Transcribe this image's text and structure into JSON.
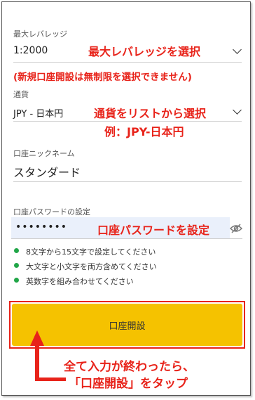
{
  "leverage": {
    "label": "最大レバレッジ",
    "value": "1:2000",
    "annotation": "最大レバレッジを選択",
    "note": "(新規口座開設は無制限を選択できません)"
  },
  "currency": {
    "label": "通貨",
    "value": "JPY - 日本円",
    "annotation_line1": "通貨をリストから選択",
    "annotation_line2": "例：JPY-日本円"
  },
  "nickname": {
    "label": "口座ニックネーム",
    "value": "スタンダード"
  },
  "password": {
    "label": "口座パスワードの設定",
    "value": "••••••••",
    "annotation": "口座パスワードを設定"
  },
  "requirements": [
    "8文字から15文字で設定してください",
    "大文字と小文字を両方含めてください",
    "英数字を組み合わせてください"
  ],
  "submit": {
    "label": "口座開設"
  },
  "instruction": {
    "line1": "全て入力が終わったら、",
    "line2": "「口座開設」をタップ"
  },
  "colors": {
    "accent": "#f5c200",
    "annotation": "#e8231a",
    "check": "#21a648"
  },
  "icons": {
    "dropdown": "chevron-down-icon",
    "password_toggle": "eye-off-icon",
    "requirement": "green-dot-icon",
    "pointer": "up-arrow-icon"
  }
}
